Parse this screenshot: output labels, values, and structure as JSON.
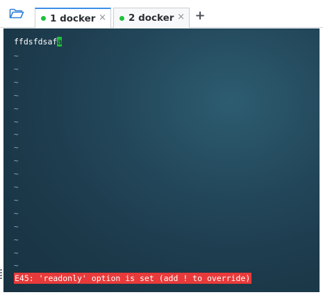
{
  "toolbar": {
    "folder_icon": "folder-open-icon",
    "add_tab_label": "+"
  },
  "tabs": [
    {
      "label": "1 docker",
      "status_color": "#1fbf3c",
      "active": true,
      "close_label": "×"
    },
    {
      "label": "2 docker",
      "status_color": "#1fbf3c",
      "active": false,
      "close_label": "×"
    }
  ],
  "terminal": {
    "text_line": "ffdsfdsaf",
    "cursor_char": "a",
    "tilde_char": "~",
    "tilde_count": 17,
    "error_message": "E45: 'readonly' option is set (add ! to override)",
    "colors": {
      "cursor": "#1fbf3c",
      "error_bg": "#e83a3a",
      "text": "#ffffff"
    }
  }
}
